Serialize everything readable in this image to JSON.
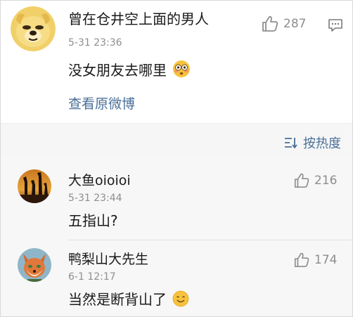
{
  "post": {
    "username": "曾在仓井空上面的男人",
    "time": "5-31 23:36",
    "likes": "287",
    "text": "没女朋友去哪里",
    "view_original": "查看原微博"
  },
  "sort": {
    "label": "按热度"
  },
  "replies": [
    {
      "username": "大鱼oioioi",
      "time": "5-31 23:44",
      "likes": "216",
      "text": "五指山?"
    },
    {
      "username": "鸭梨山大先生",
      "time": "6-1 12:17",
      "likes": "174",
      "text": "当然是断背山了"
    }
  ],
  "icons": {
    "like": "thumbs-up-icon",
    "comment": "comment-icon",
    "sort": "sort-icon",
    "flushed_emoji": "flushed-face-emoji",
    "smile_emoji": "smiling-face-emoji"
  },
  "colors": {
    "link": "#4a6f98",
    "meta": "#8e8e8e",
    "background_gray": "#f7f7f7"
  }
}
